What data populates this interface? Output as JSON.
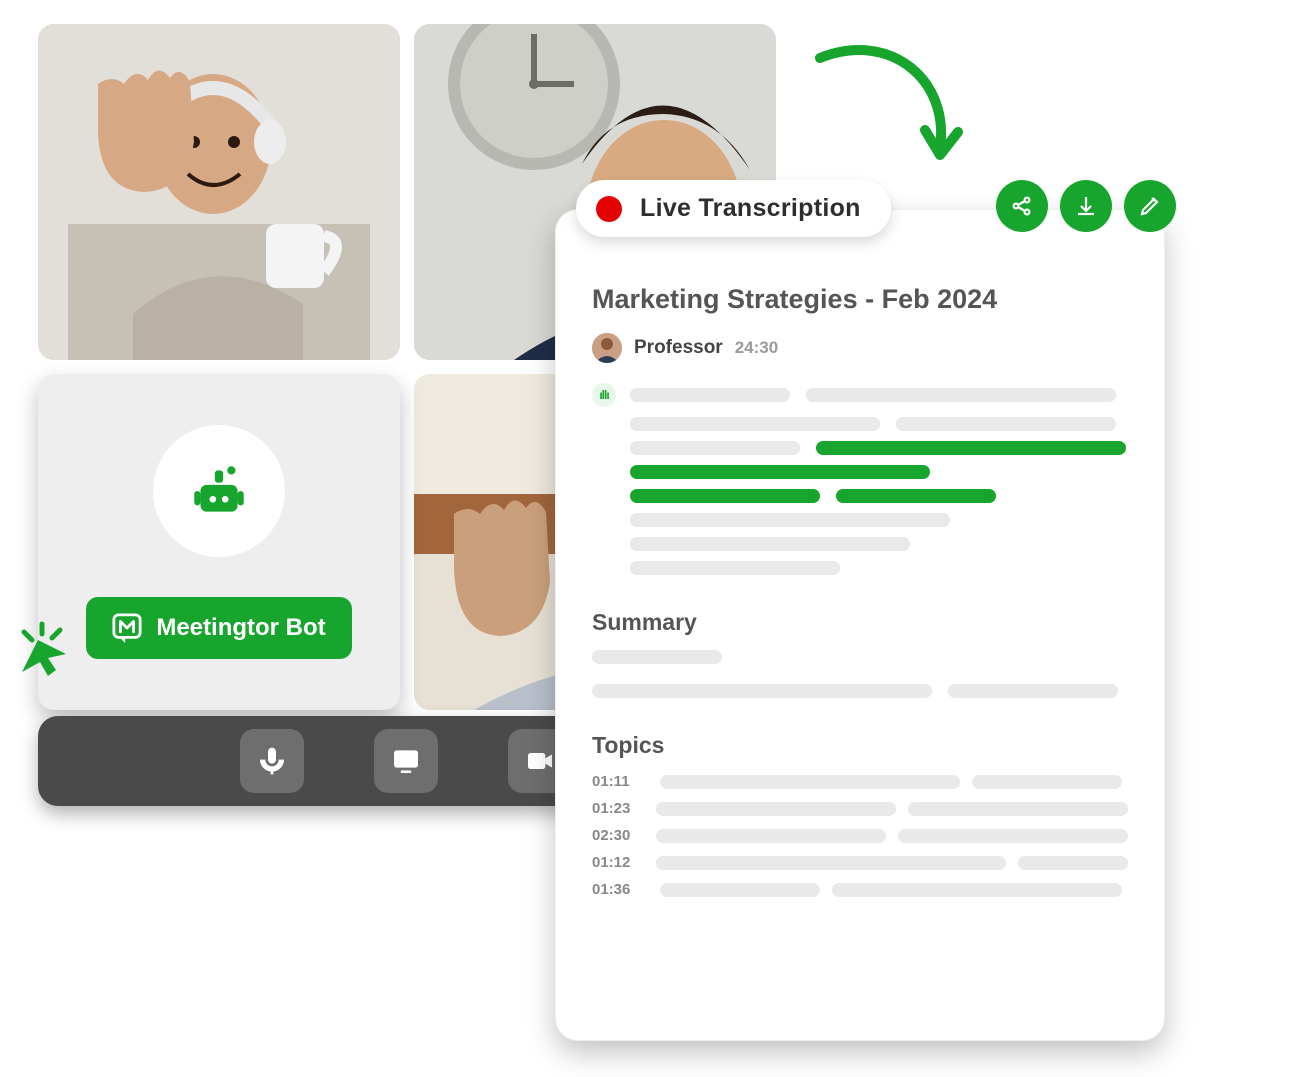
{
  "colors": {
    "accent": "#17a52e",
    "record": "#e30000"
  },
  "bot": {
    "button_label": "Meetingtor Bot"
  },
  "controls": {
    "mic": "microphone-icon",
    "share": "screen-share-icon",
    "video": "camera-icon"
  },
  "panel": {
    "live_label": "Live Transcription",
    "title": "Marketing Strategies - Feb 2024",
    "speaker": {
      "name": "Professor",
      "time": "24:30"
    },
    "summary_heading": "Summary",
    "topics_heading": "Topics",
    "topics": [
      {
        "time": "01:11"
      },
      {
        "time": "01:23"
      },
      {
        "time": "02:30"
      },
      {
        "time": "01:12"
      },
      {
        "time": "01:36"
      }
    ],
    "action_icons": {
      "share": "share-icon",
      "download": "download-icon",
      "edit": "edit-icon"
    }
  }
}
